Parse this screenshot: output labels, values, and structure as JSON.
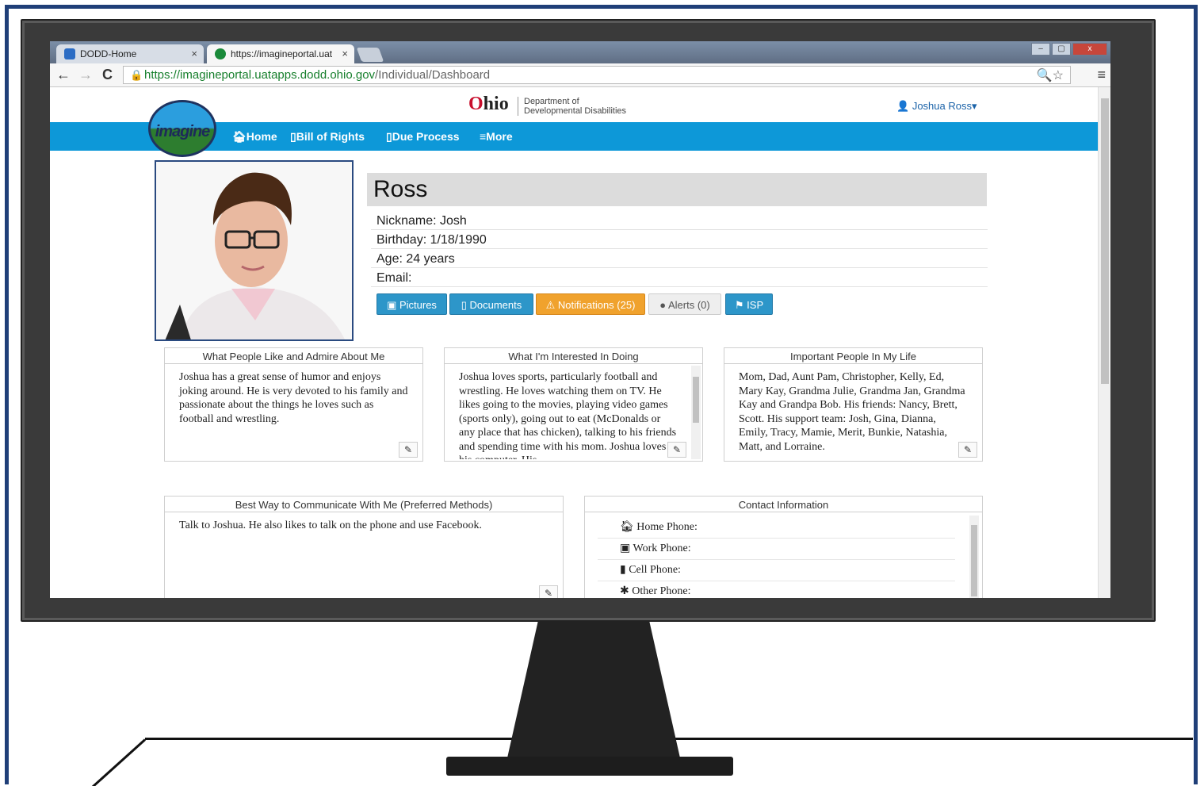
{
  "browser": {
    "tabs": [
      {
        "title": "DODD-Home",
        "close": "×",
        "favicon_color": "#2b6cc4"
      },
      {
        "title": "https://imagineportal.uat",
        "close": "×",
        "favicon_color": "#1a8a3a"
      }
    ],
    "url_host": "https://imagineportal.uatapps.dodd.ohio.gov",
    "url_path": "/Individual/Dashboard",
    "nav": {
      "back": "←",
      "forward": "→",
      "reload": "C"
    },
    "omni_icons": "🔍☆",
    "menu": "≡",
    "window_buttons": [
      "–",
      "▢",
      "x"
    ]
  },
  "header": {
    "brand_o": "O",
    "brand_rest": "hio",
    "dept_line1": "Department of",
    "dept_line2": "Developmental Disabilities",
    "user": "Joshua Ross",
    "user_icon": "person-icon",
    "logo_text": "imagine"
  },
  "nav": {
    "home": "Home",
    "bill_of_rights": "Bill of Rights",
    "due_process": "Due Process",
    "more": "More"
  },
  "profile": {
    "name": "Ross",
    "nickname": "Nickname: Josh",
    "birthday": "Birthday: 1/18/1990",
    "age": "Age: 24 years",
    "email": "Email:"
  },
  "actions": {
    "pictures": "Pictures",
    "documents": "Documents",
    "notifications": "Notifications (25)",
    "alerts": "Alerts (0)",
    "isp": "ISP"
  },
  "panels": {
    "like_admire": {
      "title": "What People Like and Admire About Me",
      "body": "Joshua has a great sense of humor and enjoys joking around. He is very devoted to his family and passionate about the things he loves such as football and wrestling."
    },
    "interests": {
      "title": "What I'm Interested In Doing",
      "body": "Joshua loves sports, particularly football and wrestling. He loves watching them on TV. He likes going to the movies, playing video games (sports only), going out to eat (McDonalds or any place that has chicken), talking to his friends and spending time with his mom. Joshua loves his computer. His"
    },
    "people": {
      "title": "Important People In My Life",
      "body": "Mom, Dad, Aunt Pam, Christopher, Kelly, Ed, Mary Kay, Grandma Julie, Grandma Jan, Grandma Kay and Grandpa Bob. His friends: Nancy, Brett, Scott. His support team: Josh, Gina, Dianna, Emily, Tracy, Mamie, Merit, Bunkie, Natashia, Matt, and Lorraine."
    },
    "communicate": {
      "title": "Best Way to Communicate With Me (Preferred Methods)",
      "body": "Talk to Joshua. He also likes to talk on the phone and use Facebook."
    },
    "contact": {
      "title": "Contact Information",
      "rows": [
        "Home Phone:",
        "Work Phone:",
        "Cell Phone:",
        "Other Phone:"
      ]
    }
  },
  "colors": {
    "nav_blue": "#0d98d8",
    "button_blue": "#2d96c9",
    "button_orange": "#f0a22d",
    "ohio_red": "#c8102e",
    "frame_blue": "#1f3f78"
  }
}
